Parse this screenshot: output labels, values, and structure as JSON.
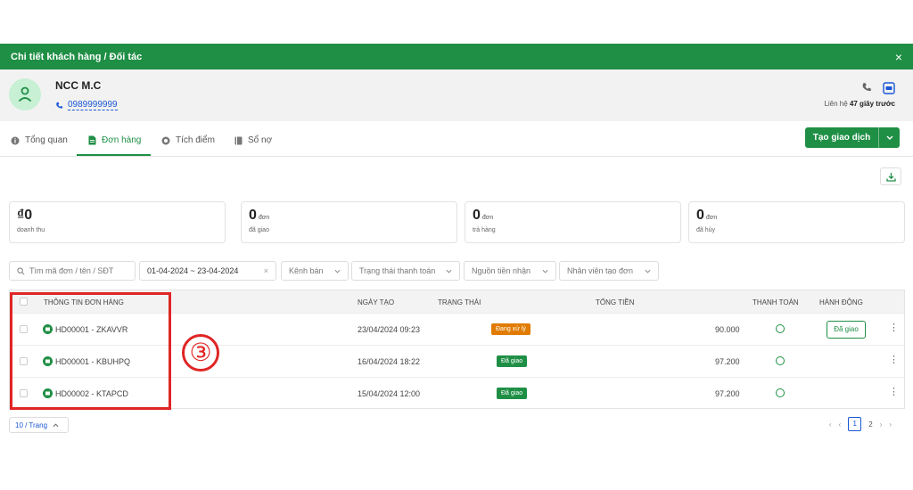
{
  "header": {
    "title": "Chi tiết khách hàng / Đối tác",
    "close": "×"
  },
  "customer": {
    "name": "NCC M.C",
    "phone": "0989999999",
    "contact_prefix": "Liên hệ",
    "contact_time": "47 giây trước"
  },
  "tabs": [
    {
      "label": "Tổng quan",
      "icon": "info-icon"
    },
    {
      "label": "Đơn hàng",
      "icon": "document-icon"
    },
    {
      "label": "Tích điểm",
      "icon": "coin-icon"
    },
    {
      "label": "Sổ nợ",
      "icon": "book-icon"
    }
  ],
  "create_button": "Tạo giao dịch",
  "stats": [
    {
      "value": "₫0",
      "unit": "",
      "label": "doanh thu"
    },
    {
      "value": "0",
      "unit": "đơn",
      "label": "đã giao"
    },
    {
      "value": "0",
      "unit": "đơn",
      "label": "trả hàng"
    },
    {
      "value": "0",
      "unit": "đơn",
      "label": "đã hủy"
    }
  ],
  "filters": {
    "search_placeholder": "Tìm mã đơn / tên / SĐT",
    "date_range": "01-04-2024 ~ 23-04-2024",
    "channel": "Kênh bán",
    "payment_status": "Trạng thái thanh toán",
    "money_source": "Nguồn tiền nhận",
    "staff": "Nhân viên tạo đơn"
  },
  "table": {
    "headers": {
      "info": "THÔNG TIN ĐƠN HÀNG",
      "date": "NGÀY TẠO",
      "status": "TRẠNG THÁI",
      "total": "TỔNG TIỀN",
      "payment": "THANH TOÁN",
      "action": "HÀNH ĐỘNG"
    },
    "rows": [
      {
        "code": "HD00001 - ZKAVVR",
        "date": "23/04/2024 09:23",
        "status": "Đang xử lý",
        "status_color": "#e07b00",
        "total": "90.000",
        "action": "Đã giao"
      },
      {
        "code": "HD00001 - KBUHPQ",
        "date": "16/04/2024 18:22",
        "status": "Đã giao",
        "status_color": "#1f8f45",
        "total": "97.200",
        "action": ""
      },
      {
        "code": "HD00002 - KTAPCD",
        "date": "15/04/2024 12:00",
        "status": "Đã giao",
        "status_color": "#1f8f45",
        "total": "97.200",
        "action": ""
      }
    ]
  },
  "annotation_step": "③",
  "pagination": {
    "page_size": "10 / Trang",
    "pages": [
      "1",
      "2"
    ],
    "current": "1"
  },
  "colors": {
    "primary": "#1f8f45",
    "highlight": "#e02525",
    "link": "#1a56d6"
  }
}
